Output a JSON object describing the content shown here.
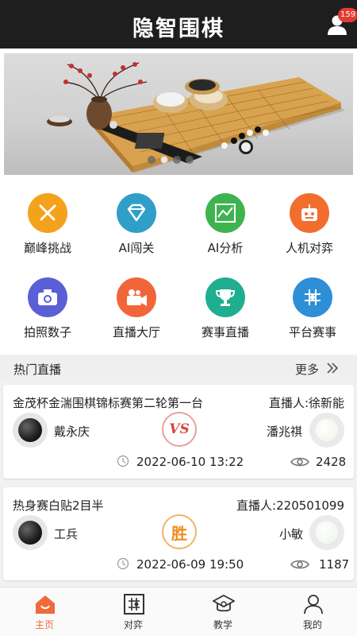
{
  "header": {
    "title": "隐智围棋",
    "notification_count": "159"
  },
  "banner": {
    "slides": 4,
    "active_slide": 2
  },
  "features": [
    {
      "label": "巅峰挑战",
      "icon": "crossed-swords-icon",
      "color": "#f4a21b"
    },
    {
      "label": "AI闯关",
      "icon": "diamond-icon",
      "color": "#2f9fc7"
    },
    {
      "label": "AI分析",
      "icon": "chart-icon",
      "color": "#3fb34f"
    },
    {
      "label": "人机对弈",
      "icon": "robot-icon",
      "color": "#f26d2e"
    },
    {
      "label": "拍照数子",
      "icon": "camera-icon",
      "color": "#5b5fd6"
    },
    {
      "label": "直播大厅",
      "icon": "video-camera-icon",
      "color": "#f2653a"
    },
    {
      "label": "赛事直播",
      "icon": "trophy-icon",
      "color": "#1fae8f"
    },
    {
      "label": "平台赛事",
      "icon": "board-icon",
      "color": "#2f8fd6"
    }
  ],
  "section": {
    "title": "热门直播",
    "more": "更多"
  },
  "live": [
    {
      "title": "金茂杯金湍围棋锦标赛第二轮第一台",
      "host": "直播人:徐新能",
      "black_player": "戴永庆",
      "white_player": "潘兆祺",
      "status": "VS",
      "datetime": "2022-06-10 13:22",
      "views": "2428"
    },
    {
      "title": "热身赛白贴2目半",
      "host": "直播人:220501099",
      "black_player": "工兵",
      "white_player": "小敏",
      "status": "胜",
      "datetime": "2022-06-09 19:50",
      "views": "1187"
    }
  ],
  "tabs": [
    {
      "label": "主页",
      "icon": "home-icon",
      "active": true
    },
    {
      "label": "对弈",
      "icon": "board-icon",
      "active": false
    },
    {
      "label": "教学",
      "icon": "graduation-cap-icon",
      "active": false
    },
    {
      "label": "我的",
      "icon": "user-icon",
      "active": false
    }
  ],
  "colors": {
    "accent": "#f06a3c",
    "header_bg": "#1e1e1e",
    "vs": "#d7493c",
    "win": "#ef8a14"
  }
}
